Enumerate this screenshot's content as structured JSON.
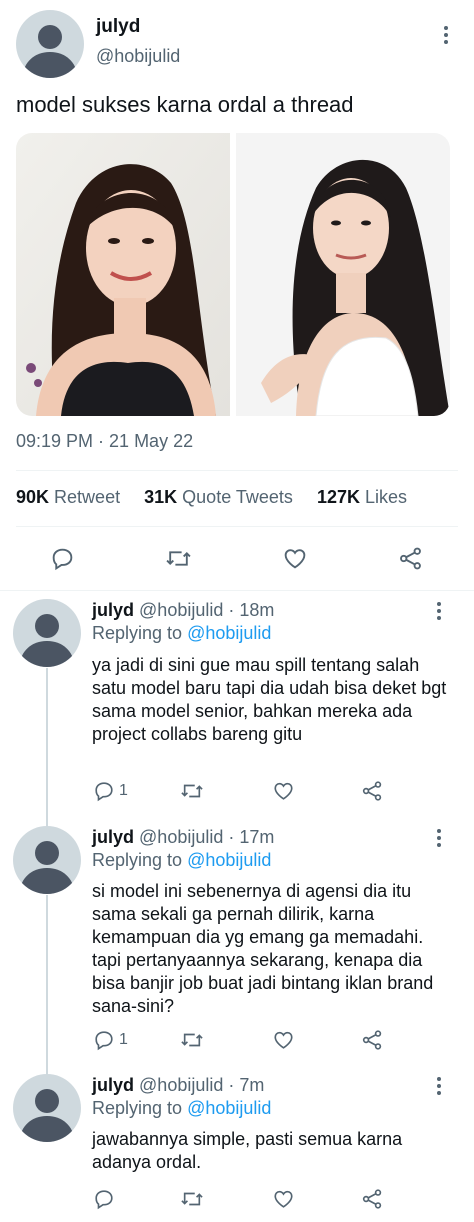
{
  "main_tweet": {
    "display_name": "julyd",
    "handle": "@hobijulid",
    "text": "model sukses karna ordal a thread",
    "timestamp": "09:19 PM · 21 May 22",
    "stats": {
      "retweets_count": "90K",
      "retweets_label": "Retweet",
      "quotes_count": "31K",
      "quotes_label": "Quote Tweets",
      "likes_count": "127K",
      "likes_label": "Likes"
    },
    "actions": [
      "reply-icon",
      "retweet-icon",
      "like-icon",
      "share-icon"
    ]
  },
  "replies": [
    {
      "display_name": "julyd",
      "handle": "@hobijulid",
      "time": "· 18m",
      "replying_prefix": "Replying to",
      "replying_handle": "@hobijulid",
      "text": "ya jadi di sini gue mau spill tentang salah satu model baru tapi dia udah bisa deket bgt sama model senior, bahkan mereka ada project collabs bareng gitu",
      "reply_count": "1"
    },
    {
      "display_name": "julyd",
      "handle": "@hobijulid",
      "time": "· 17m",
      "replying_prefix": "Replying to",
      "replying_handle": "@hobijulid",
      "text": "si model ini sebenernya di agensi dia itu sama sekali ga pernah dilirik, karna kemampuan dia yg emang ga memadahi. tapi pertanyaannya sekarang, kenapa dia bisa banjir job buat jadi bintang iklan brand sana-sini?",
      "reply_count": "1"
    },
    {
      "display_name": "julyd",
      "handle": "@hobijulid",
      "time": "· 7m",
      "replying_prefix": "Replying to",
      "replying_handle": "@hobijulid",
      "text": "jawabannya simple, pasti semua karna adanya ordal.",
      "reply_count": ""
    }
  ],
  "colors": {
    "accent": "#1d9bf0",
    "text": "#0f1419",
    "muted": "#536471",
    "divider": "#eff3f4"
  }
}
